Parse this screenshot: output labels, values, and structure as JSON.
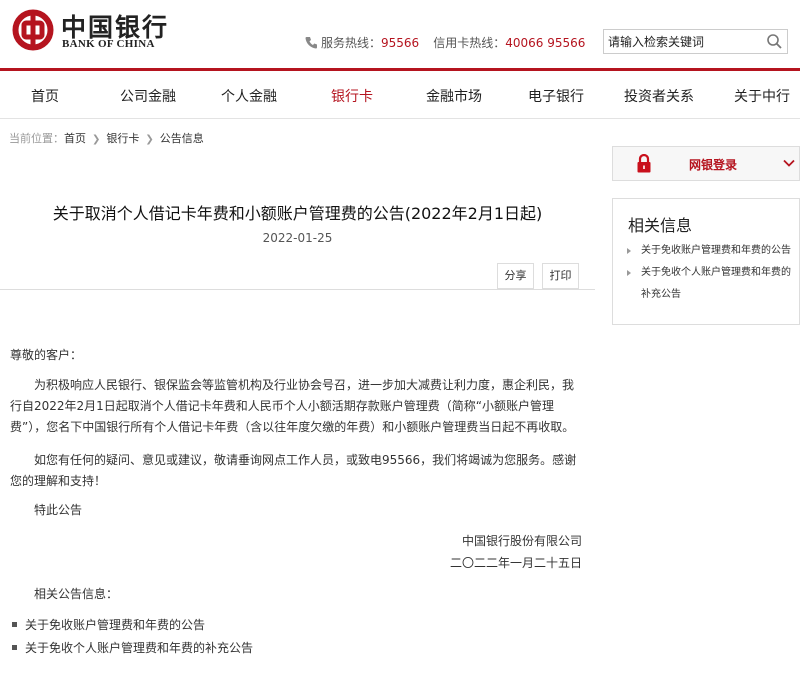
{
  "header": {
    "logo_cn": "中国银行",
    "logo_en": "BANK OF CHINA",
    "service_label": "服务热线：",
    "service_number": "95566",
    "card_label": "信用卡热线：",
    "card_number": "40066 95566",
    "search_placeholder": "请输入检索关键词"
  },
  "nav": {
    "items": [
      "首页",
      "公司金融",
      "个人金融",
      "银行卡",
      "金融市场",
      "电子银行",
      "投资者关系",
      "关于中行"
    ]
  },
  "breadcrumb": {
    "prefix": "当前位置：",
    "items": [
      "首页",
      "银行卡",
      "公告信息"
    ]
  },
  "article": {
    "title": "关于取消个人借记卡年费和小额账户管理费的公告(2022年2月1日起)",
    "date": "2022-01-25",
    "share_label": "分享",
    "print_label": "打印",
    "greeting": "尊敬的客户：",
    "para1": "为积极响应人民银行、银保监会等监管机构及行业协会号召，进一步加大减费让利力度，惠企利民，我行自2022年2月1日起取消个人借记卡年费和人民币个人小额活期存款账户管理费（简称“小额账户管理费”），您名下中国银行所有个人借记卡年费（含以往年度欠缴的年费）和小额账户管理费当日起不再收取。",
    "para2": "如您有任何的疑问、意见或建议，敬请垂询网点工作人员，或致电95566，我们将竭诚为您服务。感谢您的理解和支持！",
    "closing": "特此公告",
    "signer": "中国银行股份有限公司",
    "sign_date": "二〇二二年一月二十五日",
    "related_label": "相关公告信息：",
    "related_links": [
      "关于免收账户管理费和年费的公告",
      "关于免收个人账户管理费和年费的补充公告"
    ]
  },
  "sidebar": {
    "login_label": "网银登录",
    "related_title": "相关信息",
    "related_items": [
      "关于免收账户管理费和年费的公告",
      "关于免收个人账户管理费和年费的补充公告"
    ]
  },
  "colors": {
    "brand": "#b5141f"
  }
}
